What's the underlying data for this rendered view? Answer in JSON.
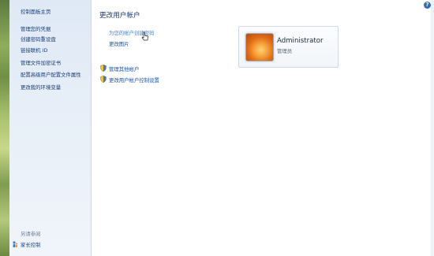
{
  "sidebar": {
    "home": "控制面板主页",
    "links": [
      "管理您的凭据",
      "创建密码重设盘",
      "链接联机 ID",
      "管理文件加密证书",
      "配置高级用户配置文件属性",
      "更改我的环境变量"
    ],
    "see_also_label": "另请参阅",
    "parental_controls": "家长控制"
  },
  "main": {
    "title": "更改用户帐户",
    "links": {
      "create_password": "为您的帐户创建密码",
      "change_picture": "更改图片",
      "manage_other": "管理其他帐户",
      "change_uac": "更改用户帐户控制设置"
    }
  },
  "account": {
    "name": "Administrator",
    "role": "管理员"
  },
  "help_icon_glyph": "?",
  "colors": {
    "link": "#1a56b0",
    "sidebar_bg": "#e4ecf6",
    "title": "#1e3a6e"
  },
  "icons": [
    "shield-icon",
    "help-icon",
    "parental-control-icon",
    "mouse-cursor-icon"
  ]
}
